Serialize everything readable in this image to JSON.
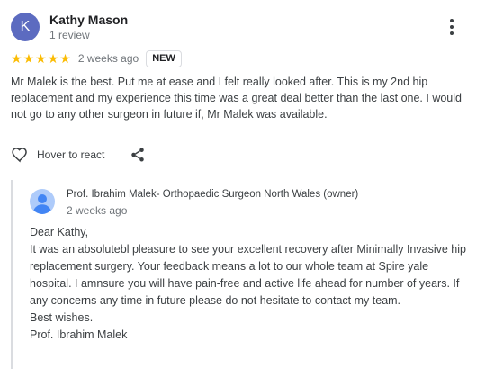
{
  "review": {
    "avatar_letter": "K",
    "avatar_color": "#5c6bc0",
    "reviewer_name": "Kathy Mason",
    "review_count": "1 review",
    "rating": 5,
    "rating_max": 5,
    "star_color": "#fbbc04",
    "date": "2 weeks ago",
    "badge": "NEW",
    "text": "Mr Malek is the best. Put me at ease and I felt really looked after. This is my 2nd hip replacement and my experience this time was a great deal better than the last one. I would not go to any other surgeon in future if, Mr Malek was available.",
    "more_icon": "more-vert-icon"
  },
  "actions": {
    "react_icon": "heart-outline-icon",
    "react_label": "Hover to react",
    "share_icon": "share-icon"
  },
  "owner_reply": {
    "avatar_icon": "person-avatar-icon",
    "name": "Prof. Ibrahim Malek- Orthopaedic Surgeon North Wales (owner)",
    "date": "2 weeks ago",
    "lines": [
      "Dear Kathy,",
      "It was an absolutebl pleasure to see your excellent recovery after Minimally Invasive hip replacement surgery. Your feedback means a lot to our whole team at Spire yale hospital. I amnsure you will have pain-free and active life ahead for number of years. If any concerns any time in future please do not hesitate to contact my team.",
      "Best wishes.",
      "Prof. Ibrahim Malek"
    ]
  }
}
